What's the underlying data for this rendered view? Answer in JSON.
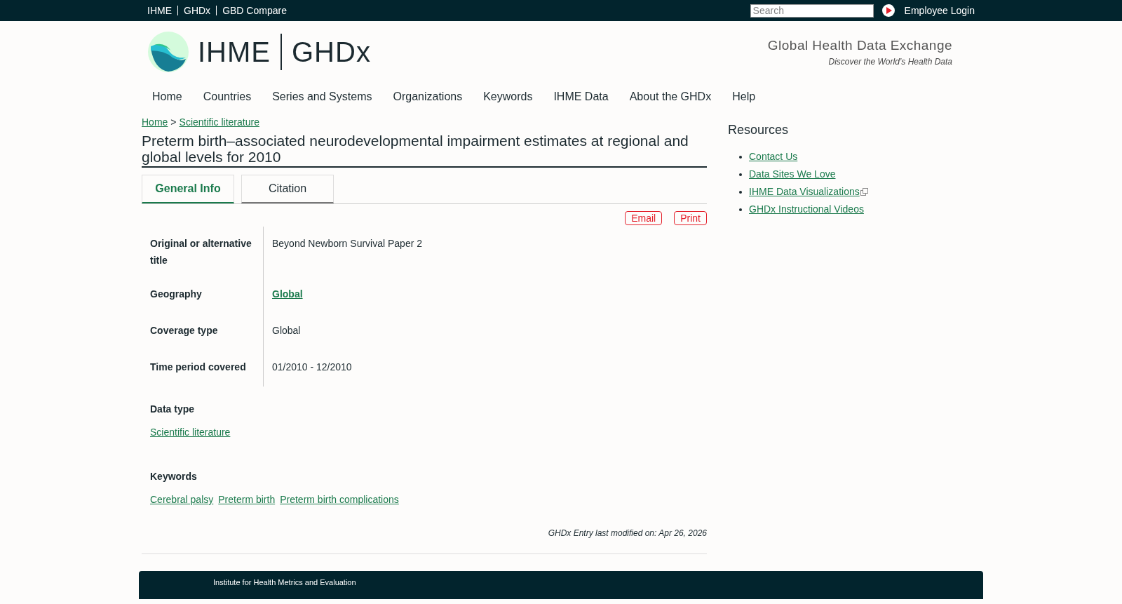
{
  "top_bar": {
    "links": [
      "IHME",
      "GHDx",
      "GBD Compare"
    ],
    "search": {
      "placeholder": "Search"
    },
    "login": "Employee Login"
  },
  "header": {
    "logo_left": "IHME",
    "logo_right": "GHDx",
    "tagline_title": "Global Health Data Exchange",
    "tagline_sub": "Discover the World’s Health Data"
  },
  "nav": [
    "Home",
    "Countries",
    "Series and Systems",
    "Organizations",
    "Keywords",
    "IHME Data",
    "About the GHDx",
    "Help"
  ],
  "breadcrumb": {
    "items": [
      "Home",
      "Scientific literature"
    ],
    "separator": ">"
  },
  "title": "Preterm birth–associated neurodevelopmental impairment estimates at regional and global levels for 2010",
  "tabs": [
    {
      "label": "General Info",
      "selected": true
    },
    {
      "label": "Citation",
      "selected": false
    }
  ],
  "actions": [
    "Email",
    "Print"
  ],
  "fields": [
    {
      "label": "Original or alternative title",
      "value": "Beyond Newborn Survival Paper 2",
      "kind": "text"
    },
    {
      "label": "Geography",
      "value": "Global",
      "kind": "link"
    },
    {
      "label": "Coverage type",
      "value": "Global",
      "kind": "text"
    },
    {
      "label": "Time period covered",
      "value": "01/2010 - 12/2010",
      "kind": "text"
    }
  ],
  "data_type": {
    "label": "Data type",
    "links": [
      "Scientific literature"
    ]
  },
  "keywords": {
    "label": "Keywords",
    "links": [
      "Cerebral palsy",
      "Preterm birth",
      "Preterm birth complications"
    ]
  },
  "modified": "GHDx Entry last modified on: Apr 26, 2026",
  "sidebar": {
    "title": "Resources",
    "links": [
      {
        "label": "Contact Us",
        "external": false
      },
      {
        "label": "Data Sites We Love",
        "external": false
      },
      {
        "label": "IHME Data Visualizations",
        "external": true
      },
      {
        "label": "GHDx Instructional Videos",
        "external": false
      }
    ]
  },
  "footer": {
    "text": "Institute for Health Metrics and Evaluation"
  }
}
